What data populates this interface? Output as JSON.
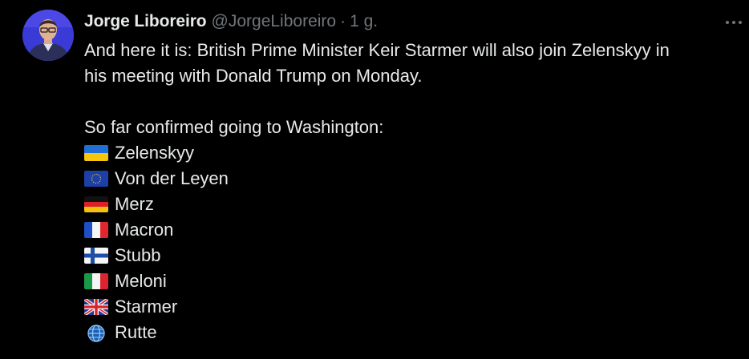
{
  "author": {
    "name": "Jorge Liboreiro",
    "handle": "@JorgeLiboreiro",
    "separator": "·",
    "time": "1 g."
  },
  "menu": {
    "icon": "more-horizontal-icon"
  },
  "tweet": {
    "line1": "And here it is: British Prime Minister Keir Starmer will also join Zelenskyy in",
    "line2": "his meeting with Donald Trump on Monday.",
    "list_intro": "So far confirmed going to Washington:",
    "attendees": [
      {
        "flag": "ukraine-flag-icon",
        "name": "Zelenskyy"
      },
      {
        "flag": "eu-flag-icon",
        "name": "Von der Leyen"
      },
      {
        "flag": "germany-flag-icon",
        "name": "Merz"
      },
      {
        "flag": "france-flag-icon",
        "name": "Macron"
      },
      {
        "flag": "finland-flag-icon",
        "name": "Stubb"
      },
      {
        "flag": "italy-flag-icon",
        "name": "Meloni"
      },
      {
        "flag": "uk-flag-icon",
        "name": "Starmer"
      },
      {
        "flag": "globe-icon",
        "name": "Rutte"
      }
    ]
  },
  "colors": {
    "background": "#000000",
    "text": "#e7e9ea",
    "secondary": "#71767b"
  }
}
